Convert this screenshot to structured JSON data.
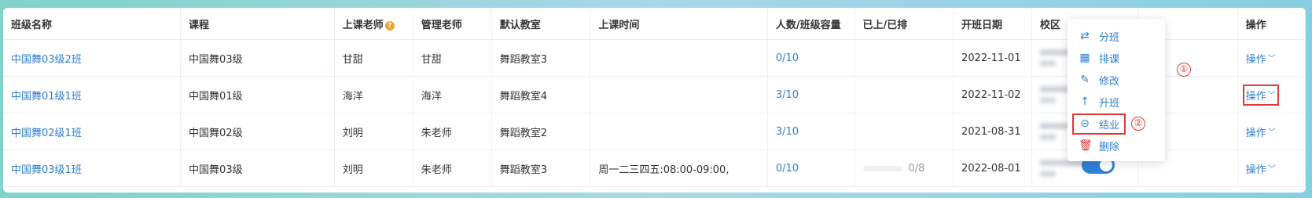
{
  "table": {
    "headers": [
      "班级名称",
      "课程",
      "上课老师",
      "管理老师",
      "默认教室",
      "上课时间",
      "人数/班级容量",
      "已上/已排",
      "开班日期",
      "校区",
      "",
      "操作"
    ],
    "rows": [
      {
        "class_name": "中国舞03级2班",
        "course": "中国舞03级",
        "teacher": "甘甜",
        "manager": "甘甜",
        "room": "舞蹈教室3",
        "time": "",
        "capacity": "0/10",
        "progress": "",
        "start_date": "2022-11-01",
        "op": "操作"
      },
      {
        "class_name": "中国舞01级1班",
        "course": "中国舞01级",
        "teacher": "海洋",
        "manager": "海洋",
        "room": "舞蹈教室4",
        "time": "",
        "capacity": "3/10",
        "progress": "",
        "start_date": "2022-11-02",
        "op": "操作"
      },
      {
        "class_name": "中国舞02级1班",
        "course": "中国舞02级",
        "teacher": "刘明",
        "manager": "朱老师",
        "room": "舞蹈教室2",
        "time": "",
        "capacity": "3/10",
        "progress": "",
        "start_date": "2021-08-31",
        "op": "操作"
      },
      {
        "class_name": "中国舞03级1班",
        "course": "中国舞03级",
        "teacher": "刘明",
        "manager": "朱老师",
        "room": "舞蹈教室3",
        "time": "周一二三四五:08:00-09:00,",
        "capacity": "0/10",
        "progress": "0/8",
        "start_date": "2022-08-01",
        "op": "操作"
      }
    ]
  },
  "help_icon": "?",
  "dropdown": {
    "items": [
      {
        "label": "分班",
        "icon": "transfer-icon",
        "glyph": "⇄"
      },
      {
        "label": "排课",
        "icon": "calendar-icon",
        "glyph": "▦"
      },
      {
        "label": "修改",
        "icon": "edit-icon",
        "glyph": "✎"
      },
      {
        "label": "升班",
        "icon": "arrow-up-icon",
        "glyph": "↑"
      },
      {
        "label": "结业",
        "icon": "graduate-icon",
        "glyph": "⊝"
      },
      {
        "label": "删除",
        "icon": "trash-icon",
        "glyph": "🗑"
      }
    ]
  },
  "annotations": [
    "①",
    "②"
  ],
  "colors": {
    "accent": "#2f7fd6",
    "highlight": "#e53935",
    "warning": "#f0a33a"
  }
}
